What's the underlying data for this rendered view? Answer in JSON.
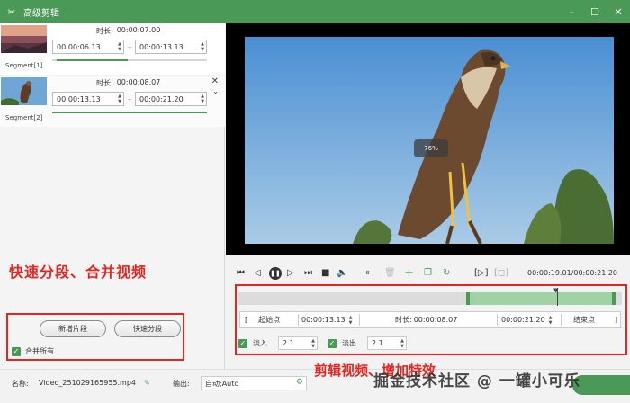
{
  "window": {
    "title": "高级剪辑",
    "app_icon": "scissors-icon",
    "minimize": "–",
    "maximize": "☐",
    "close": "✕"
  },
  "segments": [
    {
      "label": "Segment[1]",
      "duration_label": "时长:",
      "duration": "00:00:07.00",
      "start": "00:00:06.13",
      "end": "00:00:13.13"
    },
    {
      "label": "Segment[2]",
      "duration_label": "时长:",
      "duration": "00:00:08.07",
      "start": "00:00:13.13",
      "end": "00:00:21.20"
    }
  ],
  "left_panel": {
    "promo_text": "快速分段、合并视频",
    "new_segment_button": "新增片段",
    "quick_split_button": "快速分段",
    "merge_all_label": "合并所有",
    "merge_all_checked": true
  },
  "preview": {
    "zoom": "76%"
  },
  "playback": {
    "time": "00:00:19.01/00:00:21.20"
  },
  "clip_editor": {
    "start_point_button": "起始点",
    "start_time": "00:00:13.13",
    "duration_label": "时长:",
    "duration": "00:00:08.07",
    "end_time": "00:00:21.20",
    "end_point_button": "结束点",
    "fade_in_label": "淡入",
    "fade_in_value": "2.1",
    "fade_out_label": "淡出",
    "fade_out_value": "2.1",
    "fade_in_checked": true,
    "fade_out_checked": true
  },
  "footer": {
    "name_label": "名称:",
    "file_name": "Video_251029165955.mp4",
    "output_label": "输出:",
    "output_value": "自动;Auto",
    "promo_text": "剪辑视频、增加特效",
    "watermark": "掘金技术社区 @ 一罐小可乐"
  },
  "colors": {
    "accent": "#4a9957",
    "annotation_red": "#e52521"
  }
}
